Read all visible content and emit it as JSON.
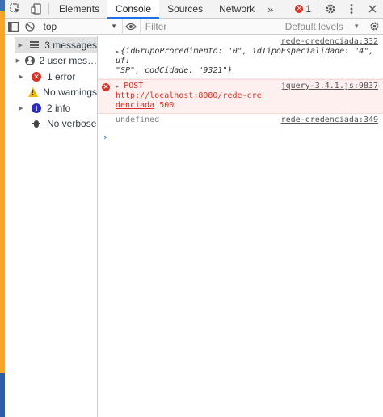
{
  "tabs": [
    "Elements",
    "Console",
    "Sources",
    "Network"
  ],
  "active_tab": "Console",
  "more_tabs_glyph": "»",
  "error_count": "1",
  "toolbar": {
    "context": "top",
    "filter_placeholder": "Filter",
    "levels": "Default levels"
  },
  "sidebar": {
    "items": [
      {
        "label": "3 messages",
        "icon": "list-icon"
      },
      {
        "label": "2 user mes…",
        "icon": "user-icon"
      },
      {
        "label": "1 error",
        "icon": "error-icon"
      },
      {
        "label": "No warnings",
        "icon": "warning-icon"
      },
      {
        "label": "2 info",
        "icon": "info-icon"
      },
      {
        "label": "No verbose",
        "icon": "bug-icon"
      }
    ]
  },
  "console": {
    "msg1": {
      "source": "rede-credenciada:332",
      "text_line1": "{idGrupoProcedimento: \"0\", idTipoEspecialidade: \"4\", uf:",
      "text_line2": "\"SP\", codCidade: \"9321\"}"
    },
    "msg2": {
      "source": "jquery-3.4.1.js:9837",
      "method": "POST",
      "url_line1": "http://localhost:8080/rede-cre",
      "url_line2": "denciada",
      "status": "500"
    },
    "msg3": {
      "source": "rede-credenciada:349",
      "text": "undefined"
    },
    "prompt": "›"
  },
  "colors": {
    "accent": "#1a73e8",
    "error": "#d93025",
    "error_bg": "#fff0f0",
    "warning": "#f2b600",
    "info": "#2b2bbd",
    "page_strip": "#f5a623"
  }
}
